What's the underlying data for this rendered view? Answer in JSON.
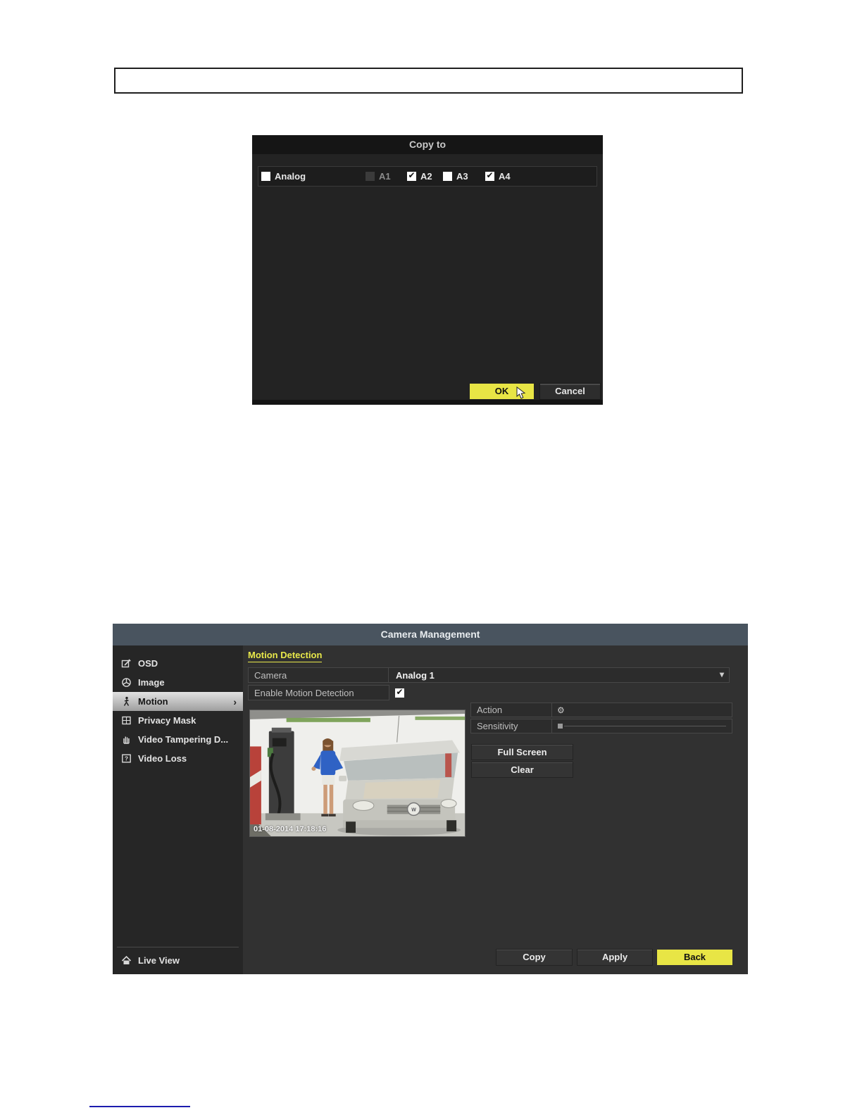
{
  "copy_dialog": {
    "title": "Copy to",
    "checkboxes": [
      {
        "label": "Analog",
        "state": "unchecked"
      },
      {
        "label": "A1",
        "state": "disabled"
      },
      {
        "label": "A2",
        "state": "checked"
      },
      {
        "label": "A3",
        "state": "unchecked"
      },
      {
        "label": "A4",
        "state": "checked"
      }
    ],
    "buttons": {
      "ok": "OK",
      "cancel": "Cancel"
    }
  },
  "camera_management": {
    "title": "Camera Management",
    "sidebar": {
      "items": [
        {
          "label": "OSD",
          "icon": "osd-edit-icon",
          "selected": false
        },
        {
          "label": "Image",
          "icon": "image-icon",
          "selected": false
        },
        {
          "label": "Motion",
          "icon": "motion-icon",
          "selected": true
        },
        {
          "label": "Privacy Mask",
          "icon": "privacy-mask-icon",
          "selected": false
        },
        {
          "label": "Video Tampering D...",
          "icon": "video-tampering-icon",
          "selected": false
        },
        {
          "label": "Video Loss",
          "icon": "video-loss-icon",
          "selected": false
        }
      ],
      "footer": {
        "label": "Live View",
        "icon": "home-icon"
      }
    },
    "content": {
      "heading": "Motion Detection",
      "rows": {
        "camera_label": "Camera",
        "camera_value": "Analog 1",
        "enable_label": "Enable Motion Detection",
        "enable_checked": true,
        "action_label": "Action",
        "action_icon": "gear-icon",
        "sensitivity_label": "Sensitivity"
      },
      "buttons": {
        "full_screen": "Full Screen",
        "clear": "Clear",
        "copy": "Copy",
        "apply": "Apply",
        "back": "Back"
      },
      "preview": {
        "timestamp": "01-08-2014 17:18:16"
      }
    }
  },
  "colors": {
    "accent_yellow": "#e8e545",
    "titlebar_slate": "#49545f",
    "link_blue": "#1c1cae"
  }
}
